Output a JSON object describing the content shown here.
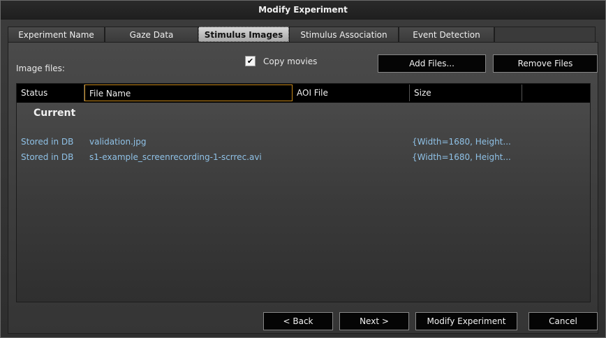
{
  "window": {
    "title": "Modify Experiment"
  },
  "tabs": [
    {
      "label": "Experiment Name",
      "active": false
    },
    {
      "label": "Gaze Data",
      "active": false
    },
    {
      "label": "Stimulus Images",
      "active": true
    },
    {
      "label": "Stimulus Association",
      "active": false
    },
    {
      "label": "Event Detection",
      "active": false
    }
  ],
  "panel": {
    "image_files_label": "Image files:",
    "copy_movies": {
      "label": "Copy movies",
      "checked": true,
      "mark": "✔"
    },
    "add_files_label": "Add Files...",
    "remove_files_label": "Remove Files"
  },
  "grid": {
    "columns": [
      "Status",
      "File Name",
      "AOI File",
      "Size",
      ""
    ],
    "group": "Current",
    "rows": [
      {
        "status": "Stored in DB",
        "file": "validation.jpg",
        "aoi": "",
        "size": "{Width=1680, Height..."
      },
      {
        "status": "Stored in DB",
        "file": "s1-example_screenrecording-1-scrrec.avi",
        "aoi": "",
        "size": "{Width=1680, Height..."
      }
    ]
  },
  "footer": {
    "back_label": "< Back",
    "next_label": "Next >",
    "modify_label": "Modify Experiment",
    "cancel_label": "Cancel"
  },
  "colors": {
    "focus_border": "#c98a1b",
    "row_text": "#8fc1e6",
    "active_tab": "#c4c4c4"
  }
}
